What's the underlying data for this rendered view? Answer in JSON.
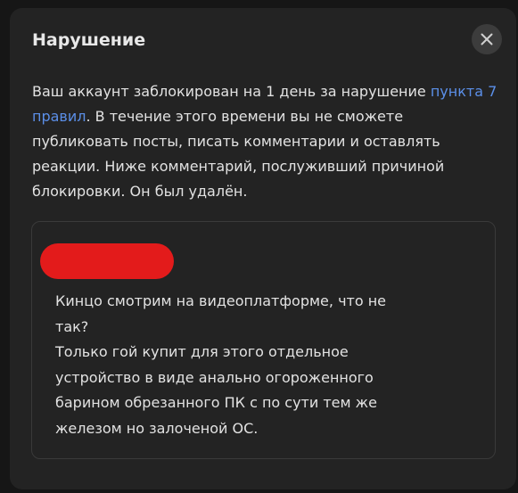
{
  "modal": {
    "title": "Нарушение",
    "close_icon": "close-icon",
    "message_before_link": "Ваш аккаунт заблокирован на 1 день за нарушение ",
    "rule_link": "пункта 7 правил",
    "message_after_link": ". В течение этого времени вы не сможете публиковать посты, писать комментарии и оставлять реакции. Ниже комментарий, послуживший причиной блокировки. Он был удалён."
  },
  "comment": {
    "text": "Кинцо смотрим на видеоплатформе, что не так?\nТолько гой купит для этого отдельное устройство в виде анально огороженного барином обрезанного ПК с по сути тем же железом но залоченой ОС."
  },
  "colors": {
    "modal_background": "#232323",
    "link": "#5b8fe8",
    "redaction": "#e31b1b"
  }
}
